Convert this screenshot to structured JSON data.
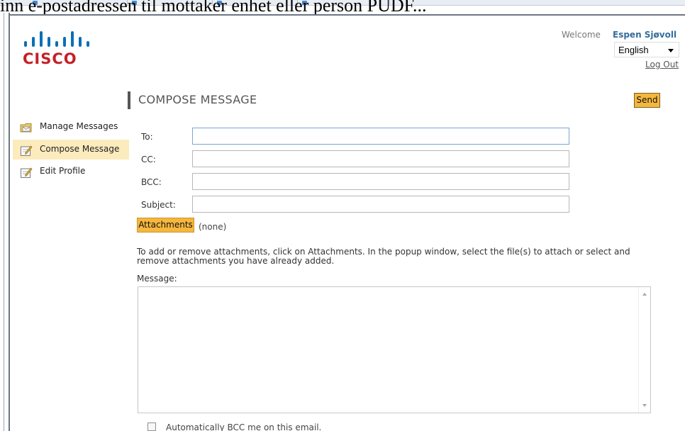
{
  "overlay": {
    "cropped_text": "inn e-postadressen til mottaker enhet eller person PUDF..."
  },
  "header": {
    "logo_text": "CISCO",
    "welcome": "Welcome",
    "user_name": "Espen Sjøvoll",
    "language": "English",
    "logout": "Log Out"
  },
  "sidebar": {
    "items": [
      {
        "label": "Manage Messages",
        "icon": "folder-mail-icon",
        "active": false
      },
      {
        "label": "Compose Message",
        "icon": "compose-icon",
        "active": true
      },
      {
        "label": "Edit Profile",
        "icon": "edit-profile-icon",
        "active": false
      }
    ]
  },
  "compose": {
    "title": "COMPOSE MESSAGE",
    "send_label": "Send",
    "fields": {
      "to_label": "To:",
      "to_value": "",
      "cc_label": "CC:",
      "cc_value": "",
      "bcc_label": "BCC:",
      "bcc_value": "",
      "subject_label": "Subject:",
      "subject_value": ""
    },
    "attachments_label": "Attachments",
    "attachments_status": "(none)",
    "help_text": "To add or remove attachments, click on Attachments. In the popup window, select the file(s) to attach or select and remove attachments you have already added.",
    "message_label": "Message:",
    "message_value": "",
    "auto_bcc_label": "Automatically BCC me on this email.",
    "auto_bcc_checked": false
  },
  "colors": {
    "accent_orange": "#f5b73e",
    "active_nav_bg": "#fcebbd",
    "logo_blue": "#0b6fb6",
    "logo_red": "#c42026",
    "user_name": "#356c9c"
  }
}
